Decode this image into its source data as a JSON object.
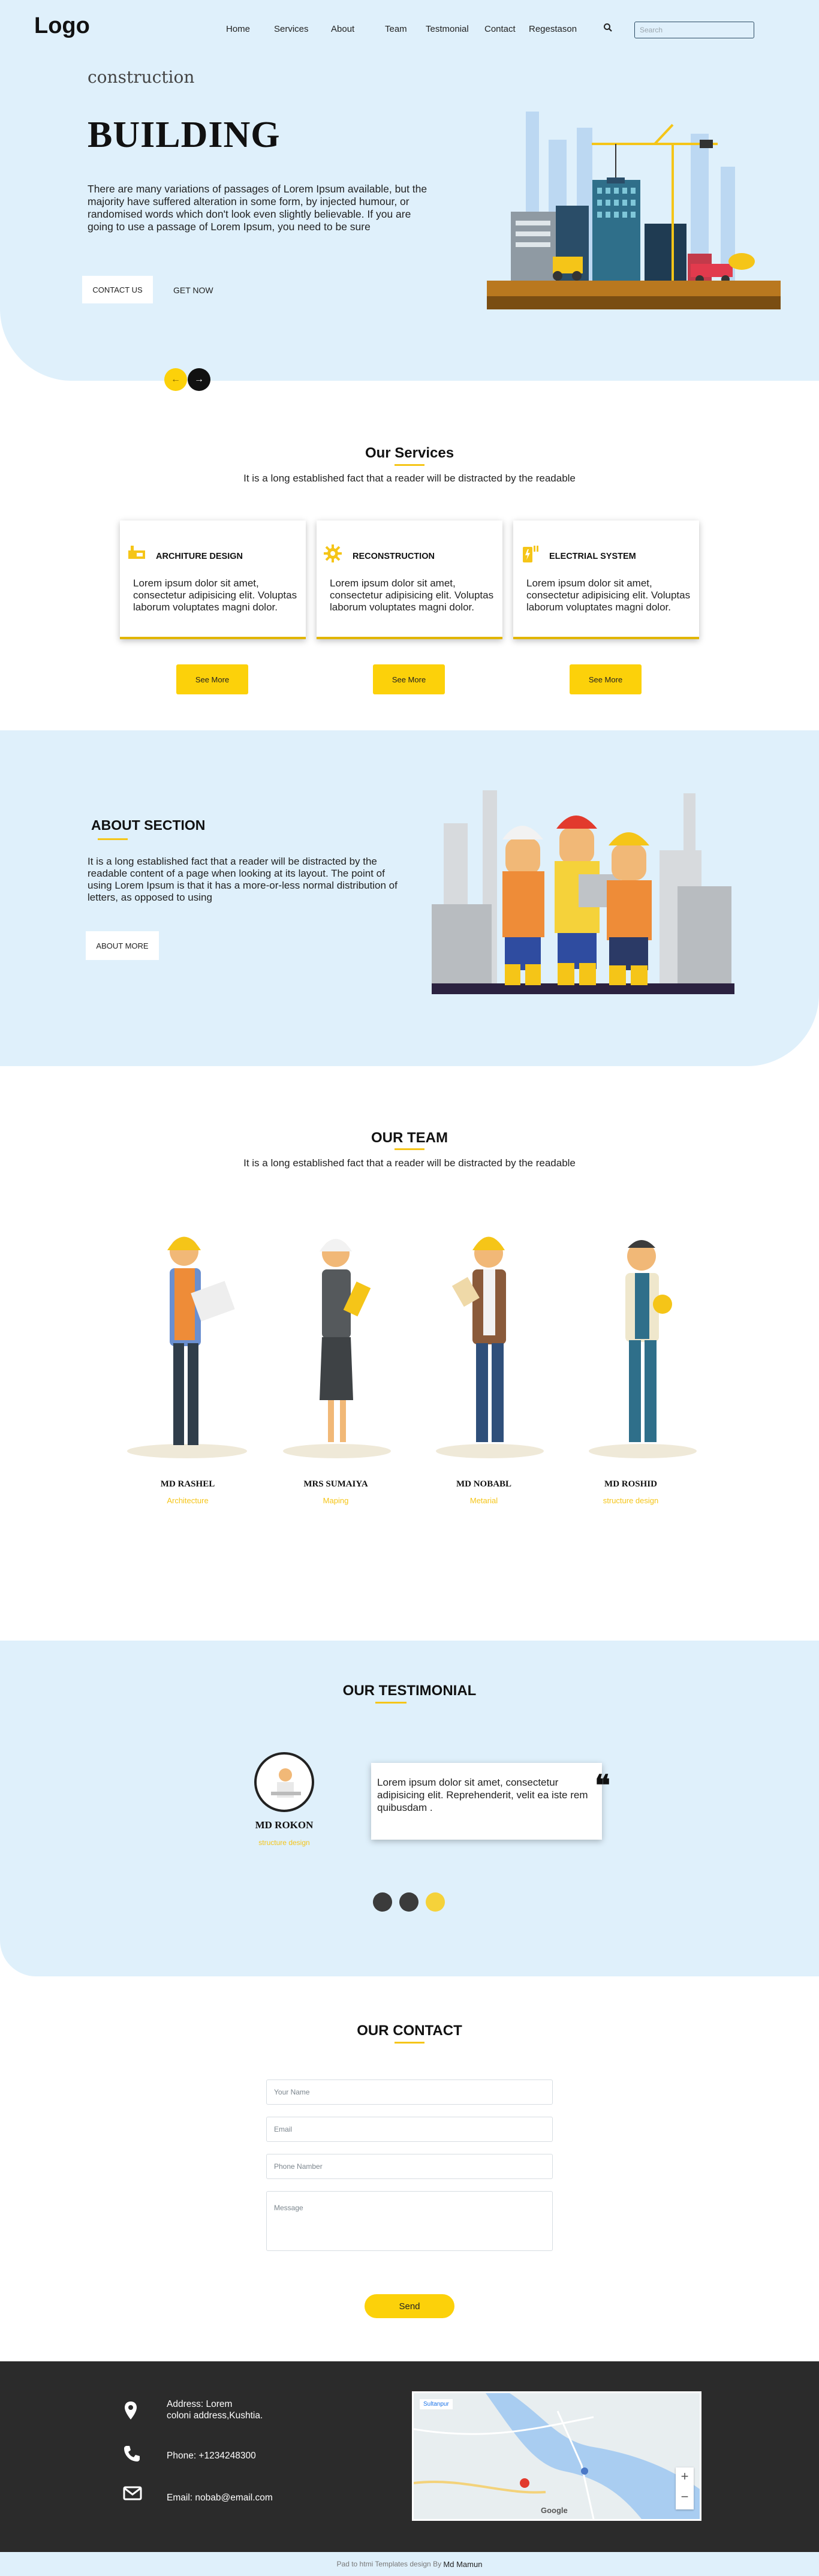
{
  "nav": {
    "logo": "Logo",
    "items": [
      "Home",
      "Services",
      "About",
      "Team",
      "Testmonial",
      "Contact",
      "Regestason"
    ],
    "search_placeholder": "Search"
  },
  "hero": {
    "subtitle": "construction",
    "title": "BUILDING",
    "text": "There are many variations of passages of Lorem Ipsum available, but the majority have suffered alteration in some form, by injected humour, or randomised words which don't look even slightly believable. If you are going to use a passage of Lorem Ipsum, you need to be sure",
    "contact_label": "CONTACT US",
    "get_label": "GET NOW",
    "prev": "←",
    "next": "→"
  },
  "services": {
    "title": "Our Services",
    "subtitle": "It is a long established fact that a reader will be distracted by the readable",
    "cards": [
      {
        "title": "ARCHITURE DESIGN",
        "text": "Lorem ipsum dolor sit amet, consectetur adipisicing elit. Voluptas laborum voluptates magni dolor.",
        "button": "See More"
      },
      {
        "title": "RECONSTRUCTION",
        "text": "Lorem ipsum dolor sit amet, consectetur adipisicing elit. Voluptas laborum voluptates magni dolor.",
        "button": "See More"
      },
      {
        "title": "ELECTRIAL SYSTEM",
        "text": "Lorem ipsum dolor sit amet, consectetur adipisicing elit. Voluptas laborum voluptates magni dolor.",
        "button": "See More"
      }
    ]
  },
  "about": {
    "title": "ABOUT SECTION",
    "text": "It is a long established fact that a reader will be distracted by the readable content of a page when looking at its layout. The point of using Lorem Ipsum is that it has a more-or-less normal distribution of letters, as opposed to using",
    "button": "ABOUT MORE"
  },
  "team": {
    "title": "OUR TEAM",
    "subtitle": "It is a long established fact that a reader will be distracted by the readable",
    "members": [
      {
        "name": "MD RASHEL",
        "role": "Architecture"
      },
      {
        "name": "MRS SUMAIYA",
        "role": "Maping"
      },
      {
        "name": "MD NOBABL",
        "role": "Metarial"
      },
      {
        "name": "MD ROSHID",
        "role": "structure design"
      }
    ]
  },
  "testimonial": {
    "title": "OUR TESTIMONIAL",
    "name": "MD ROKON",
    "role": "structure design",
    "quote": "Lorem ipsum dolor sit amet, consectetur adipisicing elit. Reprehenderit, velit ea iste rem quibusdam .",
    "quote_mark": "❝"
  },
  "contact": {
    "title": "OUR CONTACT",
    "name_placeholder": "Your Name",
    "email_placeholder": "Email",
    "phone_placeholder": "Phone Namber",
    "message_placeholder": "Message",
    "send": "Send"
  },
  "footer": {
    "address_line1": "Address: Lorem",
    "address_line2": "coloni address,Kushtia.",
    "phone": "Phone: +1234248300",
    "email": "Email: nobab@email.com",
    "map_label": "Sultanpur",
    "map_zoom_in": "+",
    "map_zoom_out": "−",
    "map_logo": "Google",
    "copyright_prefix": "Pad to htmi Templates design By",
    "copyright_author": "Md Mamun"
  },
  "colors": {
    "accent": "#fcd10a",
    "light_bg": "#dff0fb",
    "footer_bg": "#2b2b2b"
  }
}
